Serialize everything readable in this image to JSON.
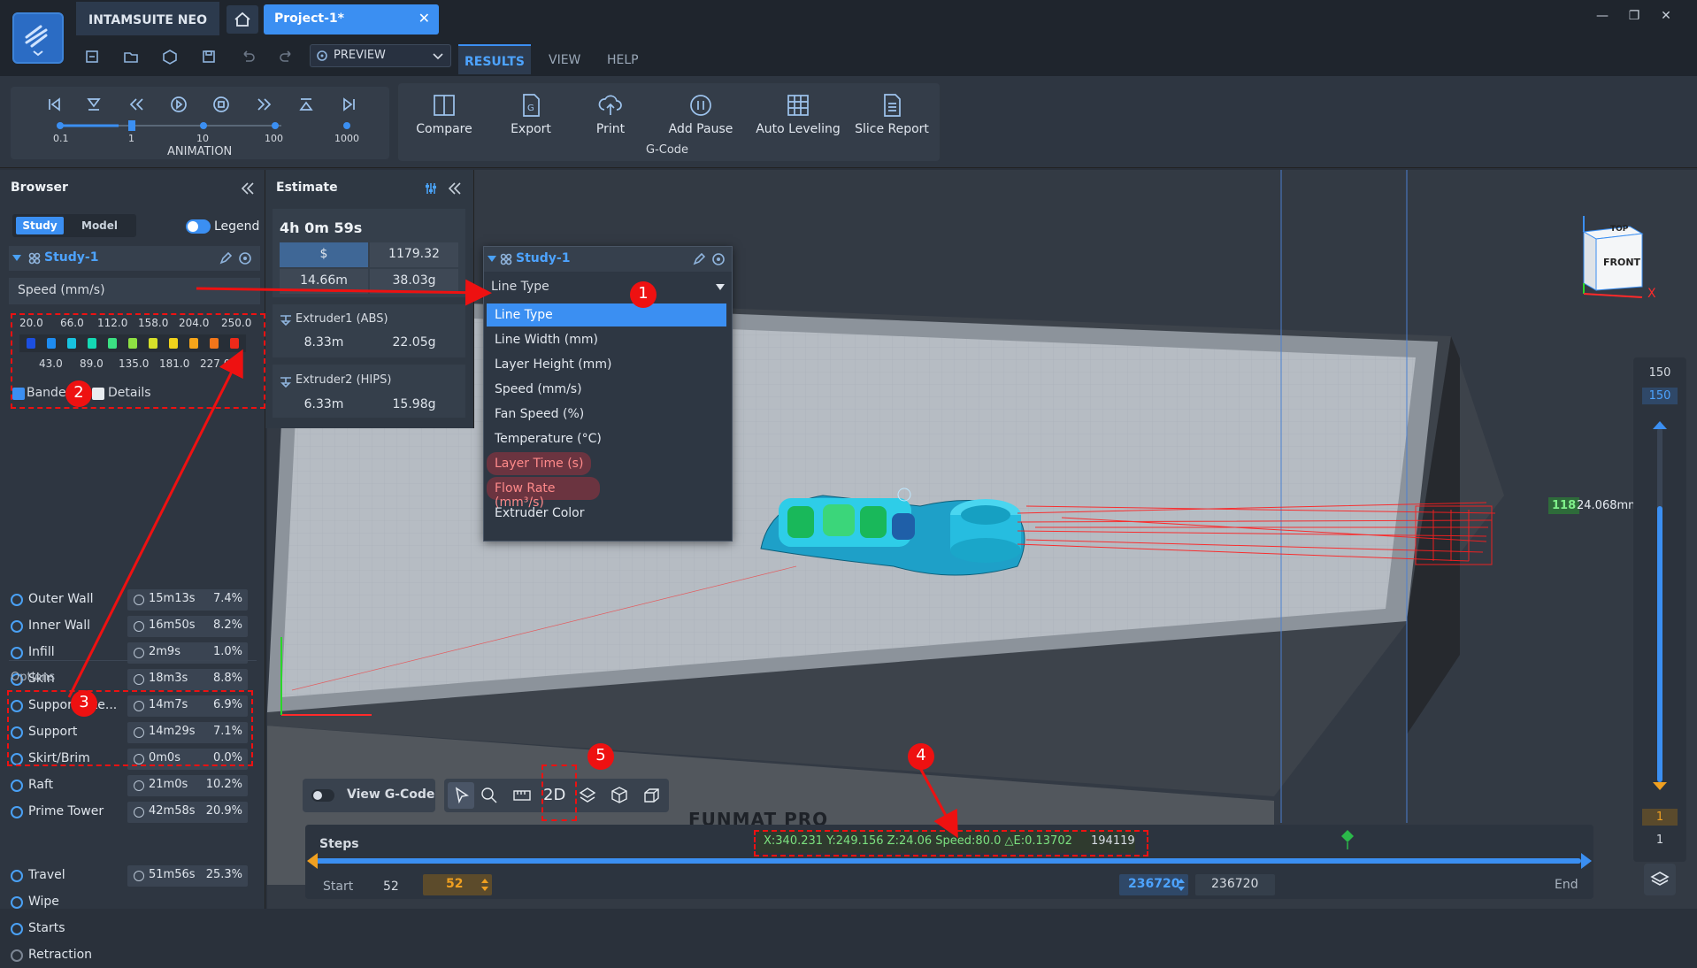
{
  "app": {
    "title": "INTAMSUITE NEO",
    "project_tab": "Project-1*",
    "close_glyph": "✕"
  },
  "window_controls": {
    "minimize": "—",
    "restore": "❐",
    "close": "✕"
  },
  "toolbar": {
    "mode_label": "PREVIEW"
  },
  "menu_tabs": {
    "results": "RESULTS",
    "view": "VIEW",
    "help": "HELP"
  },
  "animation": {
    "label": "ANIMATION",
    "speed_ticks": [
      "0.1",
      "1",
      "10",
      "100",
      "1000"
    ],
    "selected_speed": "1"
  },
  "gcode_group": {
    "label": "G-Code",
    "buttons": {
      "compare": "Compare",
      "export": "Export",
      "print": "Print",
      "add_pause": "Add Pause",
      "auto_leveling": "Auto Leveling",
      "slice_report": "Slice Report"
    }
  },
  "browser": {
    "title": "Browser",
    "tabs": {
      "study": "Study",
      "model": "Model"
    },
    "legend_label": "Legend",
    "study_name": "Study-1",
    "dropdown_value": "Speed (mm/s)",
    "scale_top": [
      "20.0",
      "66.0",
      "112.0",
      "158.0",
      "204.0",
      "250.0"
    ],
    "scale_bottom": [
      "43.0",
      "89.0",
      "135.0",
      "181.0",
      "227.0"
    ],
    "scale_colors": [
      "#1c4fe0",
      "#1e8cf0",
      "#18c3e0",
      "#14d9b4",
      "#3be083",
      "#8ee043",
      "#d6e02a",
      "#f0d21c",
      "#f5a51a",
      "#f2761a",
      "#ec2a1a"
    ],
    "banded_label": "Banded",
    "details_label": "Details",
    "features": [
      {
        "label": "Outer Wall",
        "time": "15m13s",
        "pct": "7.4%"
      },
      {
        "label": "Inner Wall",
        "time": "16m50s",
        "pct": "8.2%"
      },
      {
        "label": "Infill",
        "time": "2m9s",
        "pct": "1.0%"
      },
      {
        "label": "Skin",
        "time": "18m3s",
        "pct": "8.8%"
      },
      {
        "label": "Support Inte...",
        "time": "14m7s",
        "pct": "6.9%"
      },
      {
        "label": "Support",
        "time": "14m29s",
        "pct": "7.1%"
      },
      {
        "label": "Skirt/Brim",
        "time": "0m0s",
        "pct": "0.0%"
      },
      {
        "label": "Raft",
        "time": "21m0s",
        "pct": "10.2%"
      },
      {
        "label": "Prime Tower",
        "time": "42m58s",
        "pct": "20.9%"
      }
    ],
    "options_header": "Options",
    "options": [
      {
        "label": "Travel",
        "time": "51m56s",
        "pct": "25.3%"
      },
      {
        "label": "Wipe"
      },
      {
        "label": "Starts"
      },
      {
        "label": "Retraction"
      }
    ]
  },
  "estimate": {
    "title": "Estimate",
    "total_time": "4h 0m 59s",
    "currency": "$",
    "cost": "1179.32",
    "length": "14.66m",
    "weight": "38.03g",
    "extruders": [
      {
        "name": "Extruder1 (ABS)",
        "length": "8.33m",
        "weight": "22.05g"
      },
      {
        "name": "Extruder2 (HIPS)",
        "length": "6.33m",
        "weight": "15.98g"
      }
    ]
  },
  "study_popup": {
    "title": "Study-1",
    "selected": "Line Type",
    "options": [
      "Line Type",
      "Line Width (mm)",
      "Layer Height (mm)",
      "Speed (mm/s)",
      "Fan Speed (%)",
      "Temperature (°C)",
      "Layer Time (s)",
      "Flow Rate (mm³/s)",
      "Extruder Color"
    ]
  },
  "viewcube": {
    "top": "TOP",
    "front": "FRONT",
    "axis_x": "X"
  },
  "layer_slider": {
    "max_top": "150",
    "max_current": "150",
    "marker_layer": "118",
    "marker_height": "24.068mm",
    "min_current": "1",
    "min_bottom": "1",
    "fill_fraction": 0.78
  },
  "bottom_tools": {
    "view_gcode": "View G-Code",
    "mode_2d": "2D"
  },
  "steps": {
    "title": "Steps",
    "coords": "X:340.231 Y:249.156 Z:24.06 Speed:80.0 △E:0.13702",
    "step_index": "194119",
    "start_label": "Start",
    "start_value": "52",
    "start_current": "52",
    "end_current": "236720",
    "end_value": "236720",
    "end_label": "End"
  },
  "printer_brand": "FUNMAT PRO",
  "annotations": [
    "1",
    "2",
    "3",
    "4",
    "5"
  ],
  "colors": {
    "accent": "#3b8ff2",
    "annotation_red": "#e11111",
    "bg_dark": "#1f252d"
  }
}
